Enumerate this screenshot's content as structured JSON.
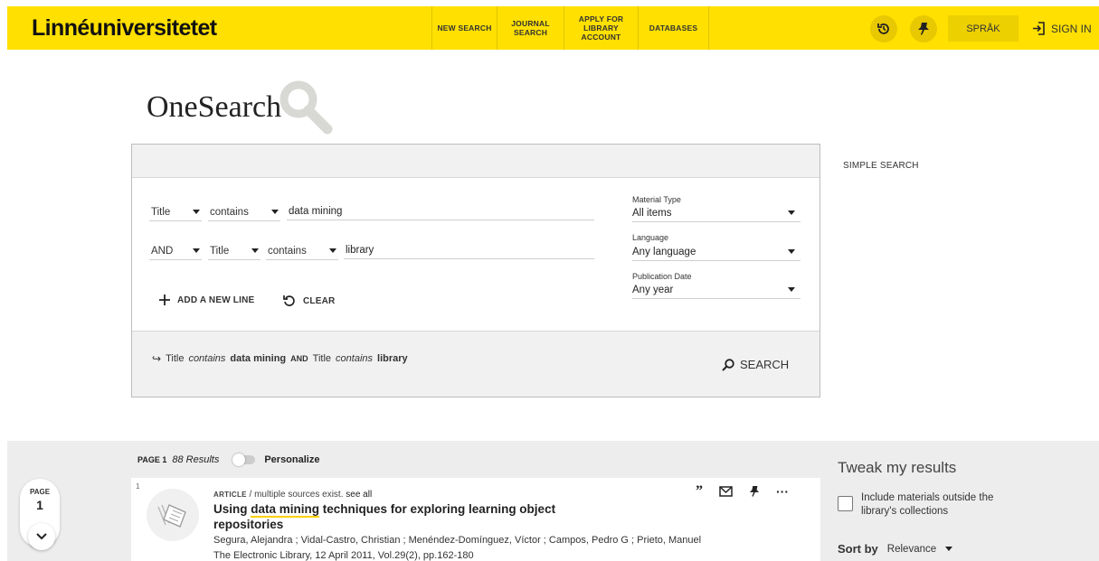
{
  "header": {
    "logo": "Linnéuniversitetet",
    "nav": [
      {
        "label": "NEW SEARCH"
      },
      {
        "label": "JOURNAL SEARCH"
      },
      {
        "label": "APPLY FOR LIBRARY ACCOUNT"
      },
      {
        "label": "DATABASES"
      }
    ],
    "language_label": "SPRÅK",
    "signin_label": "SIGN IN",
    "accent_color": "#ffe000"
  },
  "brand": {
    "name": "OneSearch"
  },
  "search": {
    "lines": [
      {
        "operator": null,
        "field": "Title",
        "condition": "contains",
        "value": "data mining"
      },
      {
        "operator": "AND",
        "field": "Title",
        "condition": "contains",
        "value": "library"
      }
    ],
    "filters": [
      {
        "label": "Material Type",
        "value": "All items"
      },
      {
        "label": "Language",
        "value": "Any language"
      },
      {
        "label": "Publication Date",
        "value": "Any year"
      }
    ],
    "add_line_label": "ADD A NEW LINE",
    "clear_label": "CLEAR",
    "summary": {
      "f1": "Title",
      "c1": "contains",
      "v1": "data mining",
      "op": "AND",
      "f2": "Title",
      "c2": "contains",
      "v2": "library"
    },
    "search_label": "SEARCH",
    "simple_search_label": "SIMPLE SEARCH"
  },
  "results": {
    "page_label": "PAGE 1",
    "count": "88 Results",
    "personalize_label": "Personalize",
    "page_indicator": {
      "label": "PAGE",
      "number": "1"
    },
    "items": [
      {
        "index": "1",
        "type": "ARTICLE",
        "type_note": "/ multiple sources exist.",
        "see_all": "see all",
        "title_before": "Using ",
        "title_highlight": "data mining",
        "title_after": " techniques for exploring learning object repositories",
        "authors": "Segura, Alejandra ; Vidal-Castro, Christian ; Menéndez-Domínguez, Víctor ; Campos, Pedro G ; Prieto, Manuel",
        "source": "The Electronic Library, 12 April 2011, Vol.29(2), pp.162-180"
      }
    ]
  },
  "sidebar": {
    "tweak_title": "Tweak my results",
    "include_outside": "Include materials outside the library's collections",
    "sort_label": "Sort by",
    "sort_value": "Relevance"
  }
}
